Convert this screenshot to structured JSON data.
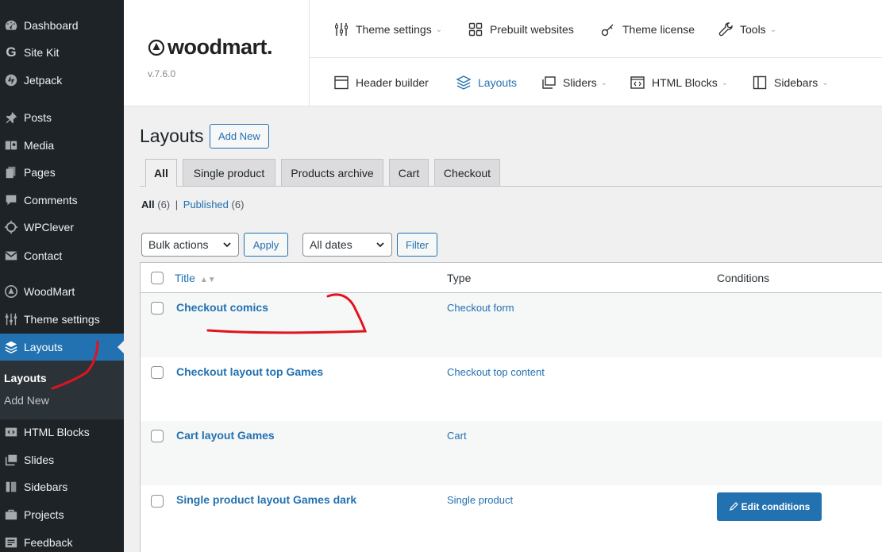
{
  "sidebar": {
    "items": [
      {
        "label": "Dashboard",
        "icon": "dashboard-icon"
      },
      {
        "label": "Site Kit",
        "icon": "google-g-icon"
      },
      {
        "label": "Jetpack",
        "icon": "jetpack-icon"
      },
      {
        "label": "Posts",
        "icon": "pin-icon"
      },
      {
        "label": "Media",
        "icon": "media-icon"
      },
      {
        "label": "Pages",
        "icon": "pages-icon"
      },
      {
        "label": "Comments",
        "icon": "comment-icon"
      },
      {
        "label": "WPClever",
        "icon": "wpclever-icon"
      },
      {
        "label": "Contact",
        "icon": "mail-icon"
      },
      {
        "label": "WoodMart",
        "icon": "woodmart-icon"
      },
      {
        "label": "Theme settings",
        "icon": "sliders-icon"
      },
      {
        "label": "Layouts",
        "icon": "layers-icon"
      },
      {
        "label": "HTML Blocks",
        "icon": "code-block-icon"
      },
      {
        "label": "Slides",
        "icon": "slides-icon"
      },
      {
        "label": "Sidebars",
        "icon": "sidebar-icon"
      },
      {
        "label": "Projects",
        "icon": "briefcase-icon"
      },
      {
        "label": "Feedback",
        "icon": "feedback-icon"
      }
    ],
    "submenu": [
      "Layouts",
      "Add New"
    ]
  },
  "woodmart": {
    "logo": "woodmart.",
    "version": "v.7.6.0",
    "top_nav": [
      "Theme settings",
      "Prebuilt websites",
      "Theme license",
      "Tools"
    ],
    "bottom_nav": [
      "Header builder",
      "Layouts",
      "Sliders",
      "HTML Blocks",
      "Sidebars"
    ]
  },
  "page": {
    "title": "Layouts",
    "add_new": "Add New"
  },
  "tabs": [
    "All",
    "Single product",
    "Products archive",
    "Cart",
    "Checkout"
  ],
  "filters": {
    "all_label": "All",
    "all_count": "(6)",
    "separator": "|",
    "published_label": "Published",
    "published_count": "(6)"
  },
  "bulk": {
    "bulk_actions": "Bulk actions",
    "apply": "Apply",
    "all_dates": "All dates",
    "filter": "Filter"
  },
  "table": {
    "columns": [
      "Title",
      "Type",
      "Conditions"
    ],
    "rows": [
      {
        "title": "Checkout comics",
        "type": "Checkout form"
      },
      {
        "title": "Checkout layout top Games",
        "type": "Checkout top content"
      },
      {
        "title": "Cart layout Games",
        "type": "Cart"
      },
      {
        "title": "Single product layout Games dark",
        "type": "Single product",
        "action": "Edit conditions"
      }
    ]
  },
  "colors": {
    "admin_sidebar": "#1d2327",
    "accent": "#2271b1",
    "annotation": "#e0141e"
  }
}
